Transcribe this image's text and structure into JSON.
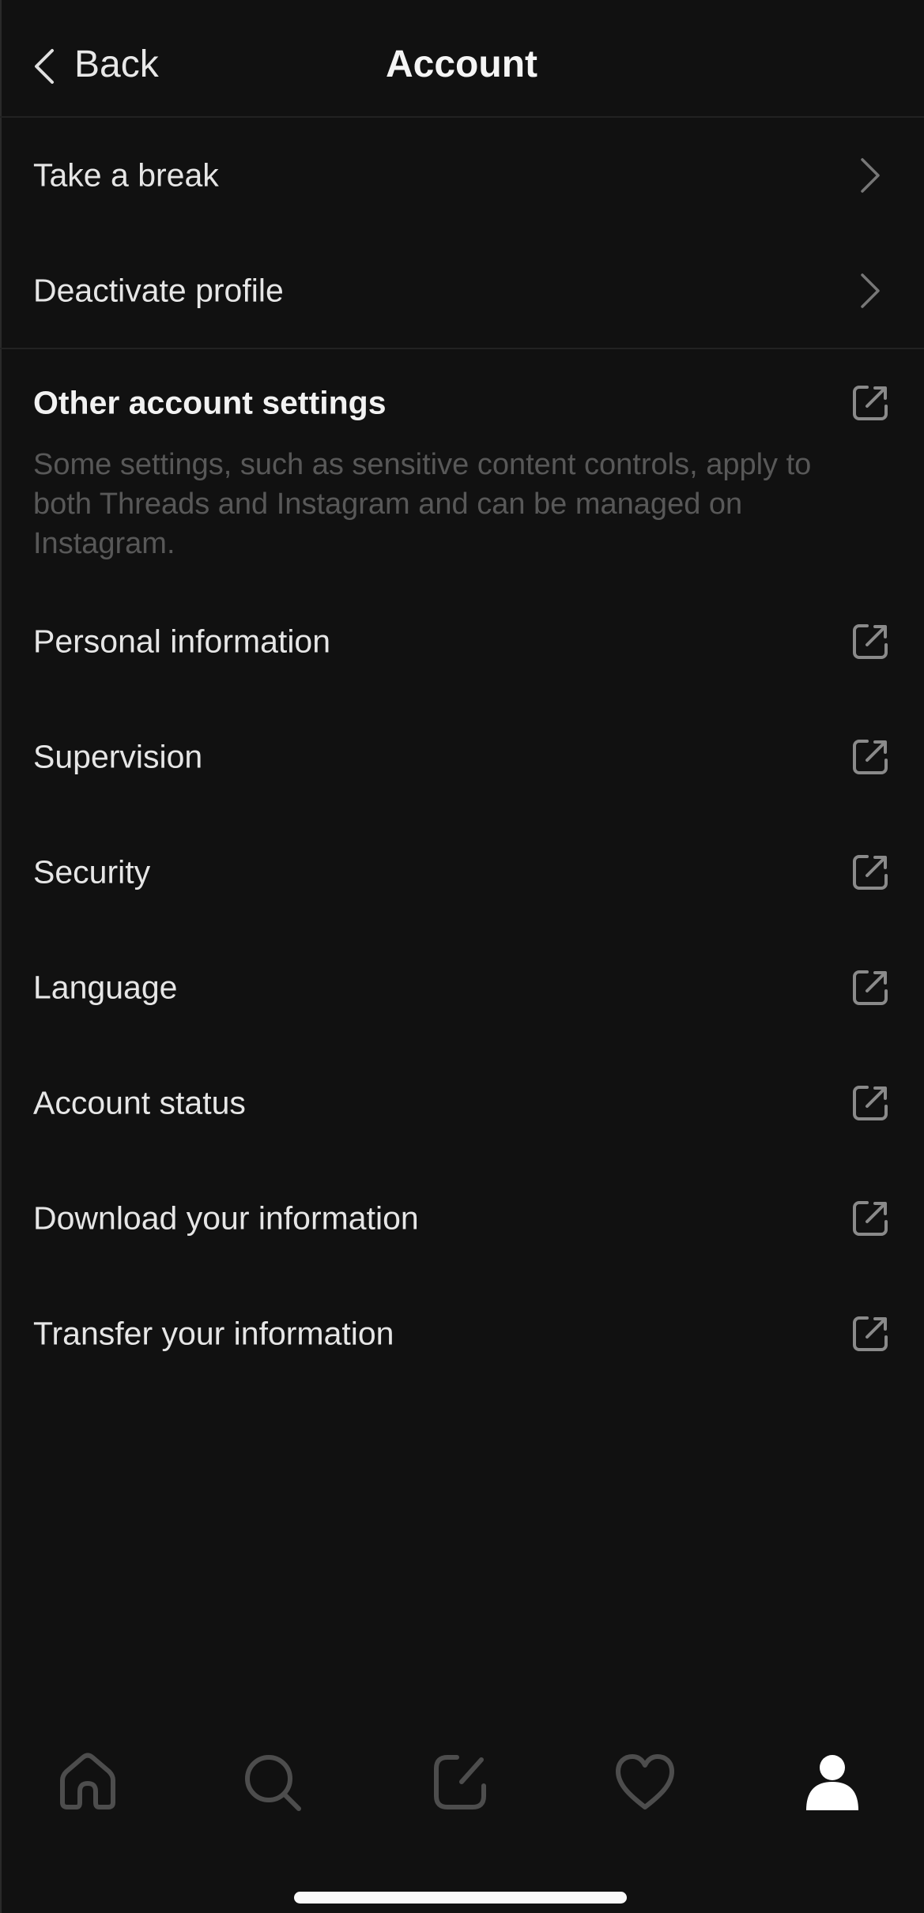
{
  "header": {
    "back_label": "Back",
    "title": "Account"
  },
  "primary_items": [
    {
      "label": "Take a break",
      "icon": "chevron-right-icon"
    },
    {
      "label": "Deactivate profile",
      "icon": "chevron-right-icon"
    }
  ],
  "other_settings": {
    "title": "Other account settings",
    "icon": "external-link-icon",
    "description": "Some settings, such as sensitive content controls, apply to both Threads and Instagram and can be managed on Instagram.",
    "items": [
      {
        "label": "Personal information",
        "icon": "external-link-icon"
      },
      {
        "label": "Supervision",
        "icon": "external-link-icon"
      },
      {
        "label": "Security",
        "icon": "external-link-icon"
      },
      {
        "label": "Language",
        "icon": "external-link-icon"
      },
      {
        "label": "Account status",
        "icon": "external-link-icon"
      },
      {
        "label": "Download your information",
        "icon": "external-link-icon"
      },
      {
        "label": "Transfer your information",
        "icon": "external-link-icon"
      }
    ]
  },
  "tabbar": {
    "tabs": [
      {
        "name": "home",
        "icon": "home-icon",
        "active": false
      },
      {
        "name": "search",
        "icon": "search-icon",
        "active": false
      },
      {
        "name": "compose",
        "icon": "compose-icon",
        "active": false
      },
      {
        "name": "activity",
        "icon": "heart-icon",
        "active": false
      },
      {
        "name": "profile",
        "icon": "profile-icon",
        "active": true
      }
    ]
  },
  "colors": {
    "background": "#111111",
    "text_primary": "#e6e6e6",
    "text_secondary": "#585858",
    "icon_inactive": "#4d4d4d",
    "icon_active": "#ffffff",
    "chevron": "#777777",
    "external_icon": "#8a8a8a"
  }
}
